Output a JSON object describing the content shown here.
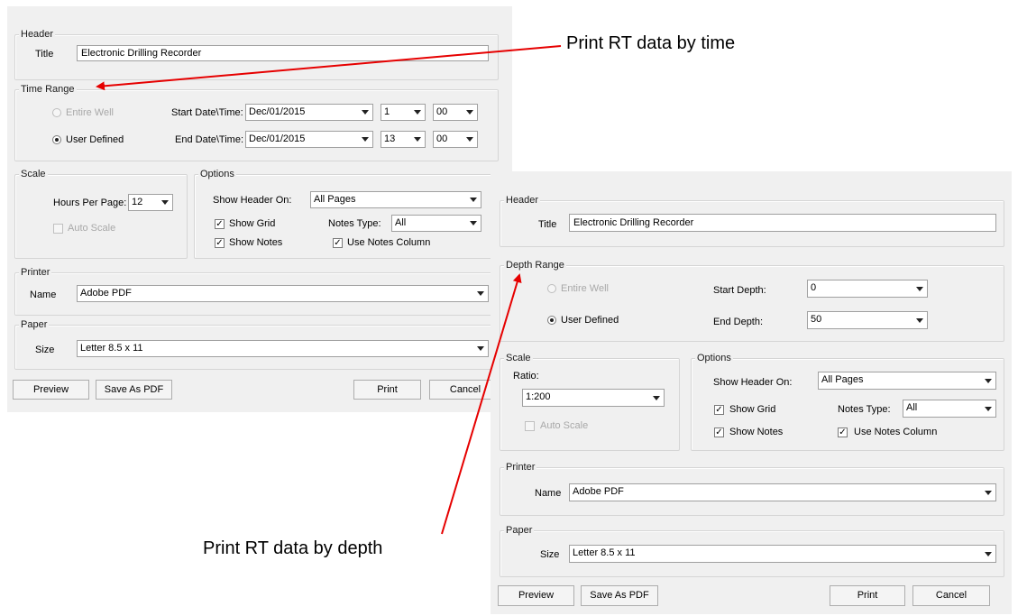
{
  "colors": {
    "arrow": "#e60000",
    "dialog_bg": "#f0f0f0"
  },
  "callouts": {
    "time": "Print RT data by time",
    "depth": "Print RT data by depth"
  },
  "dialog_time": {
    "header_legend": "Header",
    "title_label": "Title",
    "title_value": "Electronic Drilling Recorder",
    "time_range_legend": "Time Range",
    "entire_well": "Entire Well",
    "user_defined": "User Defined",
    "start_label": "Start Date\\Time:",
    "start_date": "Dec/01/2015",
    "start_hour": "1",
    "start_min": "00",
    "end_label": "End Date\\Time:",
    "end_date": "Dec/01/2015",
    "end_hour": "13",
    "end_min": "00",
    "scale_legend": "Scale",
    "hours_label": "Hours Per Page:",
    "hours_value": "12",
    "auto_scale": "Auto Scale",
    "options_legend": "Options",
    "show_header_label": "Show Header On:",
    "show_header_value": "All Pages",
    "show_grid": "Show Grid",
    "notes_type_label": "Notes Type:",
    "notes_type_value": "All",
    "show_notes": "Show Notes",
    "use_notes_column": "Use Notes Column",
    "printer_legend": "Printer",
    "name_label": "Name",
    "printer_value": "Adobe PDF",
    "paper_legend": "Paper",
    "size_label": "Size",
    "paper_value": "Letter 8.5 x 11",
    "preview": "Preview",
    "save_pdf": "Save As PDF",
    "print": "Print",
    "cancel": "Cancel"
  },
  "dialog_depth": {
    "header_legend": "Header",
    "title_label": "Title",
    "title_value": "Electronic Drilling Recorder",
    "depth_range_legend": "Depth Range",
    "entire_well": "Entire Well",
    "user_defined": "User Defined",
    "start_label": "Start Depth:",
    "start_value": "0",
    "end_label": "End Depth:",
    "end_value": "50",
    "scale_legend": "Scale",
    "ratio_label": "Ratio:",
    "ratio_value": "1:200",
    "auto_scale": "Auto Scale",
    "options_legend": "Options",
    "show_header_label": "Show Header On:",
    "show_header_value": "All Pages",
    "show_grid": "Show Grid",
    "notes_type_label": "Notes Type:",
    "notes_type_value": "All",
    "show_notes": "Show Notes",
    "use_notes_column": "Use Notes Column",
    "printer_legend": "Printer",
    "name_label": "Name",
    "printer_value": "Adobe PDF",
    "paper_legend": "Paper",
    "size_label": "Size",
    "paper_value": "Letter 8.5 x 11",
    "preview": "Preview",
    "save_pdf": "Save As PDF",
    "print": "Print",
    "cancel": "Cancel"
  }
}
